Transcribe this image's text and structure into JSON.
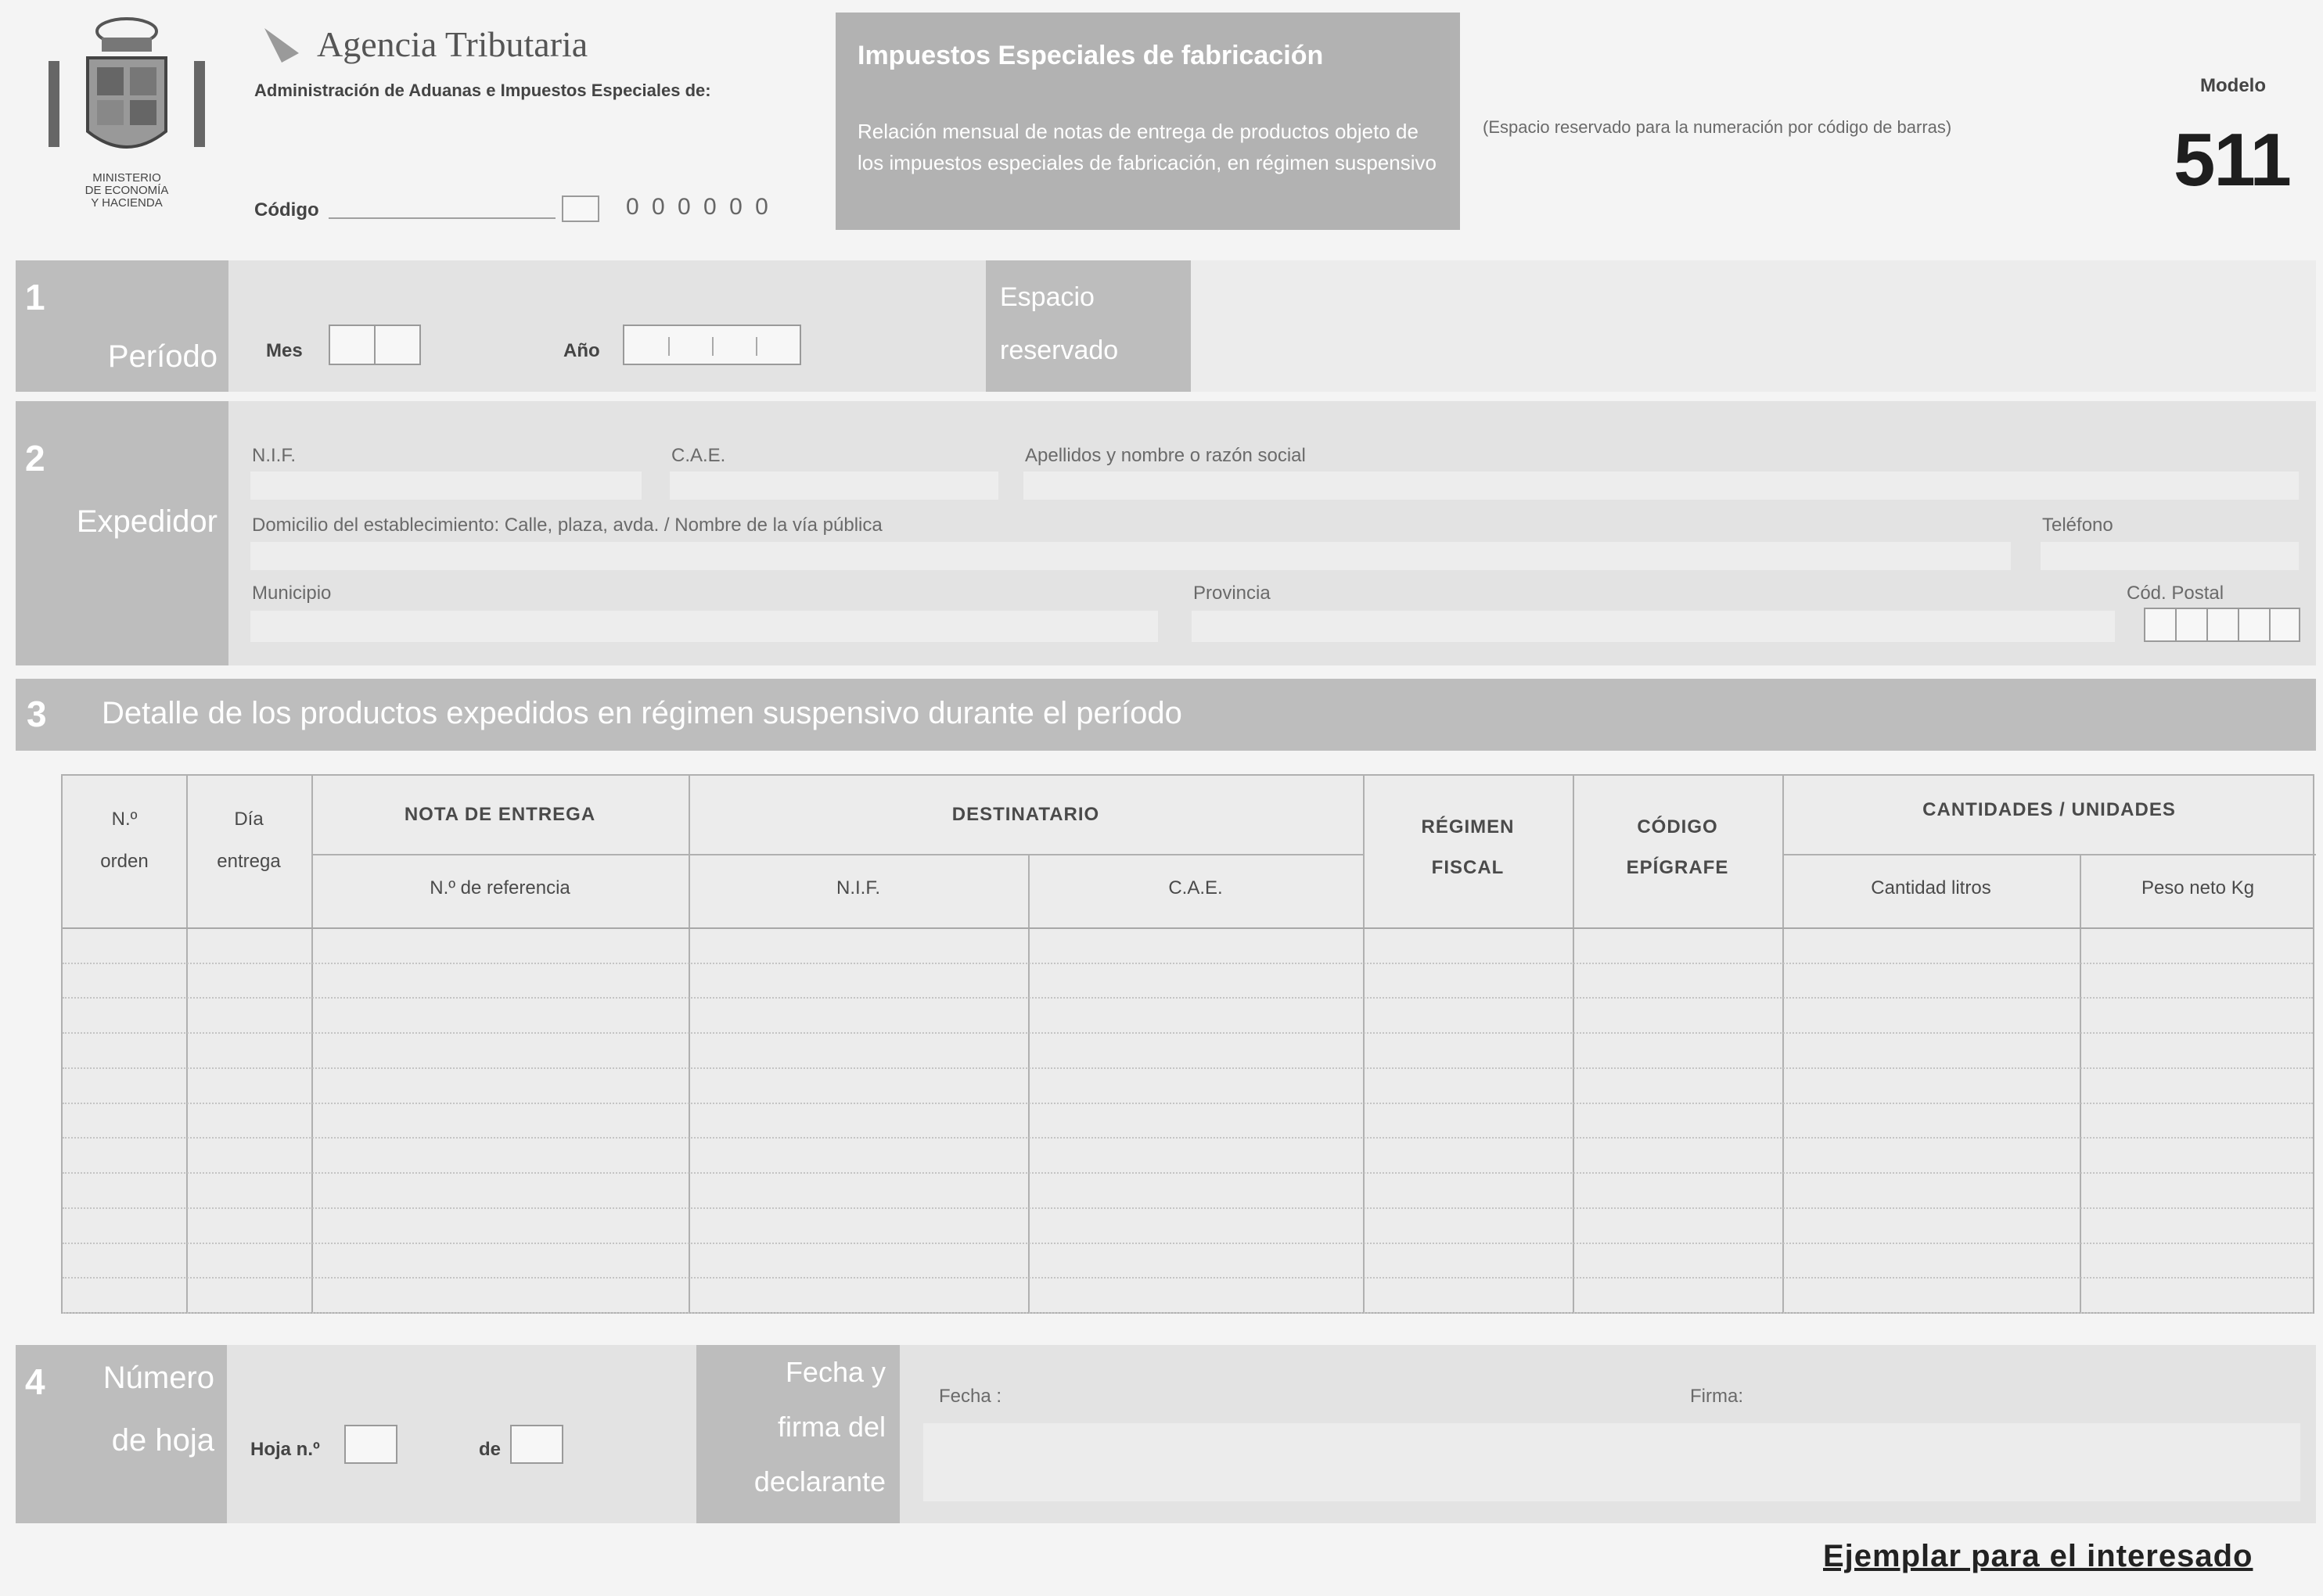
{
  "header": {
    "ministry": [
      "MINISTERIO",
      "DE ECONOMÍA",
      "Y HACIENDA"
    ],
    "agency": "Agencia Tributaria",
    "administration": "Administración de Aduanas e Impuestos Especiales de:",
    "codigo_label": "Código",
    "codigo_value": "0 0 0 0 0 0",
    "impuestos_title": "Impuestos Especiales de fabricación",
    "impuestos_desc": "Relación mensual de notas de entrega de productos objeto de los impuestos especiales de fabricación, en régimen suspensivo",
    "barcode_note": "(Espacio reservado para la numeración por código de barras)",
    "modelo_label": "Modelo",
    "modelo_number": "511"
  },
  "section1": {
    "num": "1",
    "title": "Período",
    "mes_label": "Mes",
    "anio_label": "Año",
    "side_label": [
      "Espacio",
      "reservado"
    ]
  },
  "section2": {
    "num": "2",
    "title": "Expedidor",
    "nif_label": "N.I.F.",
    "cae_label": "C.A.E.",
    "nombre_label": "Apellidos y nombre o razón social",
    "domicilio_label": "Domicilio del establecimiento: Calle, plaza, avda. / Nombre de la vía pública",
    "telefono_label": "Teléfono",
    "municipio_label": "Municipio",
    "provincia_label": "Provincia",
    "cp_label": "Cód. Postal"
  },
  "section3": {
    "num": "3",
    "title": "Detalle de los productos expedidos en régimen suspensivo durante el período"
  },
  "table": {
    "orden": [
      "N.º",
      "orden"
    ],
    "dia": [
      "Día",
      "entrega"
    ],
    "nota_entrega": "NOTA DE ENTREGA",
    "referencia": "N.º de referencia",
    "destinatario": "DESTINATARIO",
    "nif": "N.I.F.",
    "cae": "C.A.E.",
    "regimen": [
      "RÉGIMEN",
      "FISCAL"
    ],
    "codigo": [
      "CÓDIGO",
      "EPÍGRAFE"
    ],
    "cantidades": "CANTIDADES / UNIDADES",
    "litros": "Cantidad litros",
    "peso": "Peso neto Kg",
    "row_count": 11
  },
  "section4": {
    "num": "4",
    "title": [
      "Número",
      "de hoja"
    ],
    "hoja_label": "Hoja n.º",
    "de_label": "de",
    "side_title": [
      "Fecha y",
      "firma del",
      "declarante"
    ],
    "fecha_label": "Fecha :",
    "firma_label": "Firma:"
  },
  "footer": {
    "ejemplar": "Ejemplar para el interesado"
  }
}
